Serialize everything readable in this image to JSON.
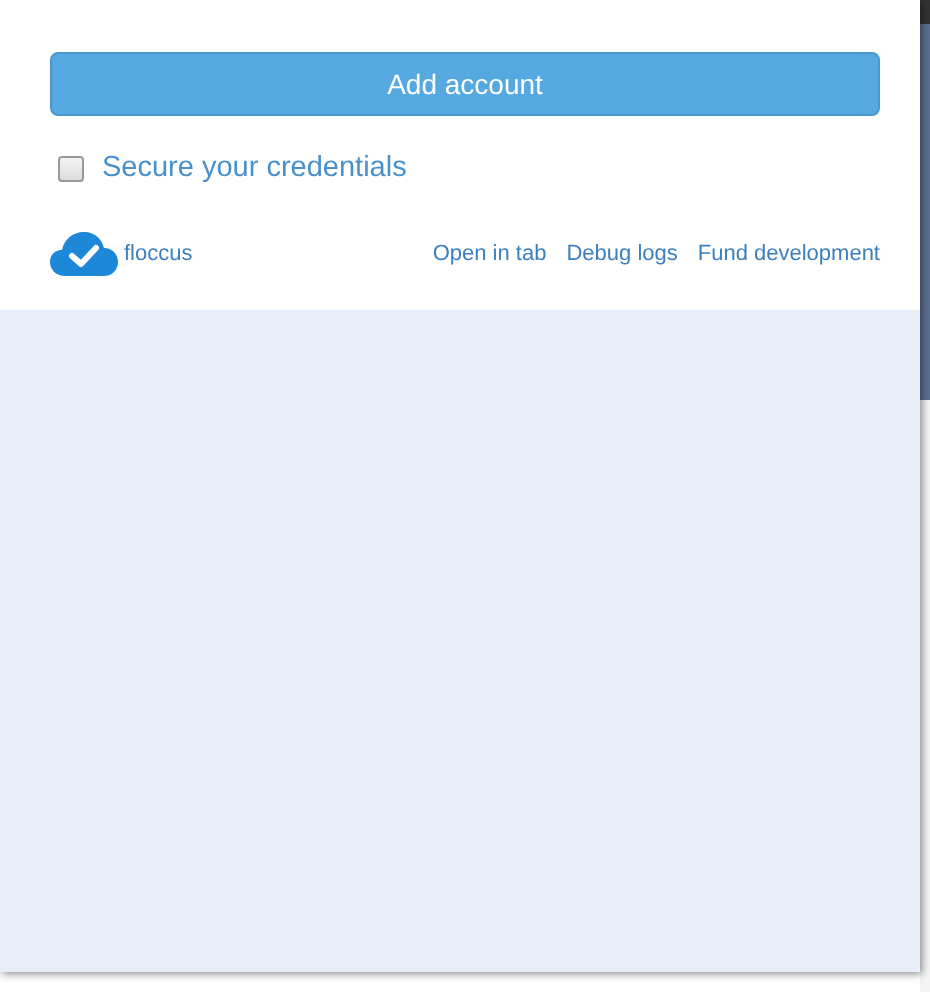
{
  "add_account_button": "Add account",
  "secure_credentials": {
    "label": "Secure your credentials",
    "checked": false
  },
  "footer": {
    "brand": "floccus",
    "links": [
      "Open in tab",
      "Debug logs",
      "Fund development"
    ]
  }
}
